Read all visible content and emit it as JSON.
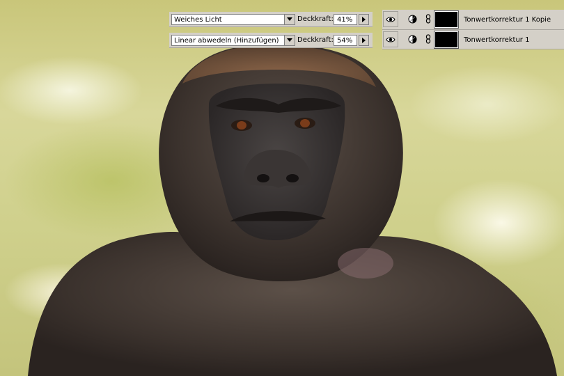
{
  "blend_rows": [
    {
      "mode": "Weiches Licht",
      "opacity_label": "Deckkraft:",
      "opacity": "41%"
    },
    {
      "mode": "Linear abwedeln (Hinzufügen)",
      "opacity_label": "Deckkraft:",
      "opacity": "54%"
    }
  ],
  "layers": [
    {
      "name": "Tonwertkorrektur 1 Kopie",
      "icon": "levels-adjustment-icon",
      "visible": true
    },
    {
      "name": "Tonwertkorrektur 1",
      "icon": "levels-adjustment-icon",
      "visible": true
    }
  ],
  "colors": {
    "panel": "#d4d0c8",
    "field": "#ffffff",
    "mask": "#000000"
  }
}
